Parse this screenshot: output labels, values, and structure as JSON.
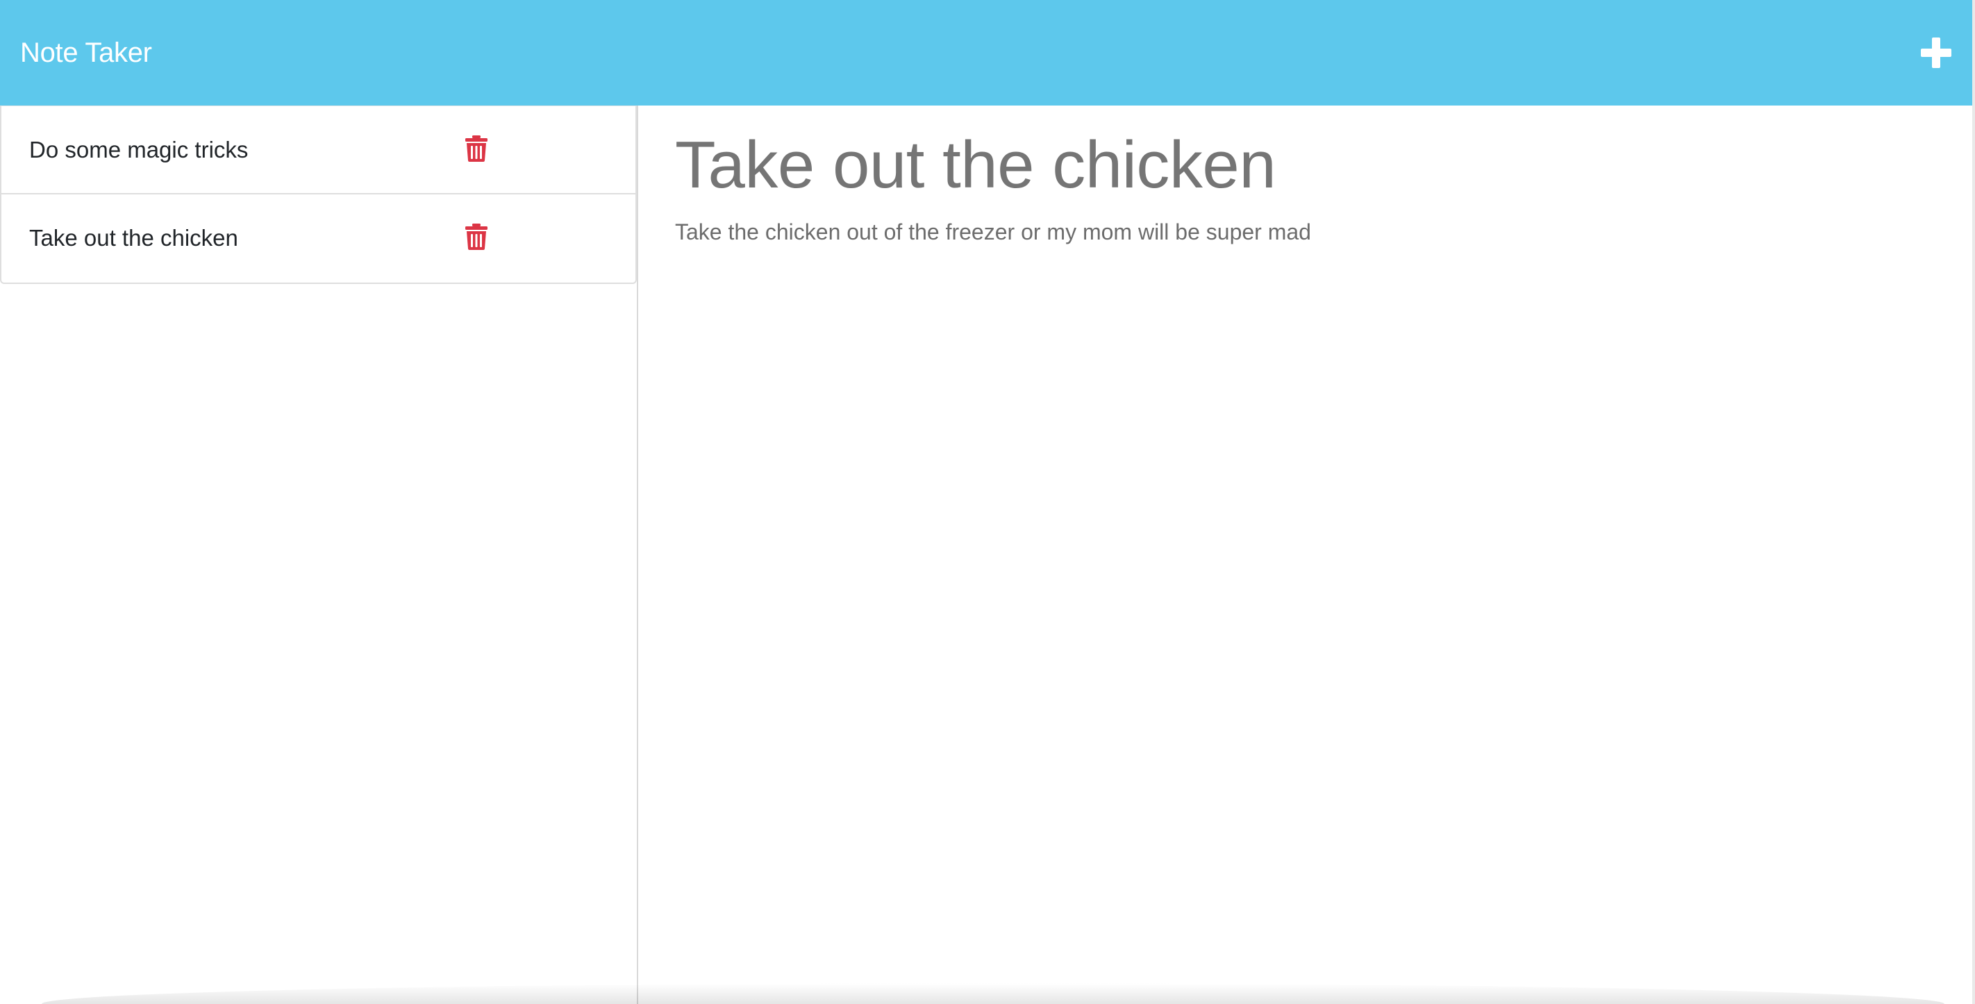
{
  "navbar": {
    "title": "Note Taker",
    "new_note_icon": "plus-icon"
  },
  "notes": [
    {
      "title": "Do some magic tricks",
      "delete_icon": "trash-icon"
    },
    {
      "title": "Take out the chicken",
      "delete_icon": "trash-icon"
    }
  ],
  "editor": {
    "title": "Take out the chicken",
    "body": "Take the chicken out of the freezer or my mom will be super mad"
  },
  "colors": {
    "navbar_bg": "#5dc8ec",
    "delete_icon": "#dc3545",
    "title_text": "#757575"
  }
}
